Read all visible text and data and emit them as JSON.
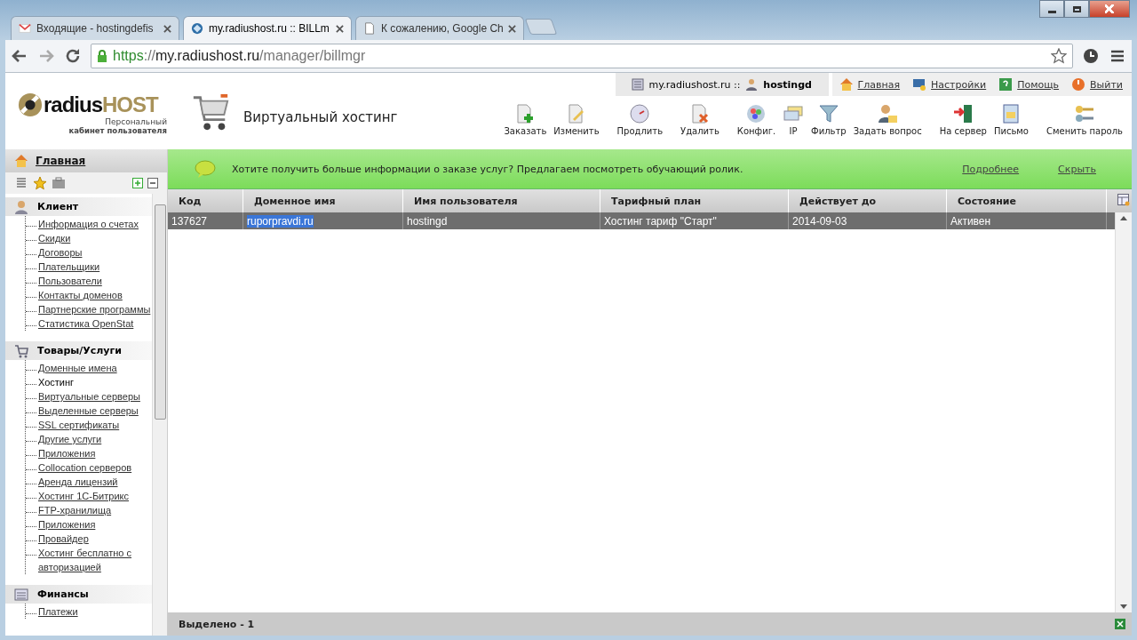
{
  "browser": {
    "tabs": [
      {
        "title": "Входящие - hostingdefis",
        "kind": "mail",
        "selected": false
      },
      {
        "title": "my.radiushost.ru :: BILLm",
        "kind": "site",
        "selected": true
      },
      {
        "title": "К сожалению, Google Ch",
        "kind": "page",
        "selected": false
      }
    ],
    "address": {
      "scheme": "https",
      "separator": "://",
      "host": "my.radiushost.ru",
      "path": "/manager/billmgr"
    }
  },
  "header": {
    "logo": {
      "part_1": "radius",
      "part_2": "HOST",
      "subtitle_1": "Персональный",
      "subtitle_2": "кабинет пользователя"
    },
    "page_title": "Виртуальный хостинг",
    "session": {
      "site": "my.radiushost.ru ::",
      "user": "hostingd"
    },
    "links": [
      {
        "label": "Главная",
        "kind": "home"
      },
      {
        "label": "Настройки",
        "kind": "settings"
      },
      {
        "label": "Помощь",
        "kind": "help"
      },
      {
        "label": "Выйти",
        "kind": "logout"
      }
    ],
    "toolbar": [
      {
        "label": "Заказать",
        "kind": "add"
      },
      {
        "label": "Изменить",
        "kind": "edit"
      },
      {
        "label": "Продлить",
        "kind": "renew"
      },
      {
        "label": "Удалить",
        "kind": "delete"
      },
      {
        "label": "Конфиг.",
        "kind": "config"
      },
      {
        "label": "IP",
        "kind": "ip"
      },
      {
        "label": "Фильтр",
        "kind": "filter"
      },
      {
        "label": "Задать вопрос",
        "kind": "ask"
      },
      {
        "label": "На сервер",
        "kind": "server"
      },
      {
        "label": "Письмо",
        "kind": "mail"
      },
      {
        "label": "Сменить пароль",
        "kind": "password"
      }
    ]
  },
  "sidebar": {
    "home": "Главная",
    "sections": [
      {
        "title": "Клиент",
        "kind": "client",
        "items": [
          {
            "label": "Информация о счетах",
            "selected": false
          },
          {
            "label": "Скидки",
            "selected": false
          },
          {
            "label": "Договоры",
            "selected": false
          },
          {
            "label": "Плательщики",
            "selected": false
          },
          {
            "label": "Пользователи",
            "selected": false
          },
          {
            "label": "Контакты доменов",
            "selected": false
          },
          {
            "label": "Партнерские программы",
            "selected": false
          },
          {
            "label": "Статистика OpenStat",
            "selected": false
          }
        ]
      },
      {
        "title": "Товары/Услуги",
        "kind": "goods",
        "items": [
          {
            "label": "Доменные имена",
            "selected": false
          },
          {
            "label": "Хостинг",
            "selected": true
          },
          {
            "label": "Виртуальные серверы",
            "selected": false
          },
          {
            "label": "Выделенные серверы",
            "selected": false
          },
          {
            "label": "SSL сертификаты",
            "selected": false
          },
          {
            "label": "Другие услуги",
            "selected": false
          },
          {
            "label": "Приложения",
            "selected": false
          },
          {
            "label": "Collocation серверов",
            "selected": false
          },
          {
            "label": "Аренда лицензий",
            "selected": false
          },
          {
            "label": "Хостинг 1С-Битрикс",
            "selected": false
          },
          {
            "label": "FTP-хранилища",
            "selected": false
          },
          {
            "label": "Приложения",
            "selected": false
          },
          {
            "label": "Провайдер",
            "selected": false
          },
          {
            "label": "Хостинг бесплатно с авторизацией",
            "selected": false
          }
        ]
      },
      {
        "title": "Финансы",
        "kind": "finance",
        "items": [
          {
            "label": "Платежи",
            "selected": false
          }
        ]
      }
    ]
  },
  "banner": {
    "message": "Хотите получить больше информации о заказе услуг? Предлагаем посмотреть обучающий ролик.",
    "links": [
      "Подробнее",
      "Скрыть"
    ]
  },
  "table": {
    "columns": [
      "Код",
      "Доменное имя",
      "Имя пользователя",
      "Тарифный план",
      "Действует до",
      "Состояние"
    ],
    "rows": [
      {
        "cells": [
          "137627",
          "ruporpravdi.ru",
          "hostingd",
          "Хостинг тариф \"Старт\"",
          "2014-09-03",
          "Активен"
        ],
        "selected": true
      }
    ]
  },
  "status_bar": "Выделено - 1"
}
